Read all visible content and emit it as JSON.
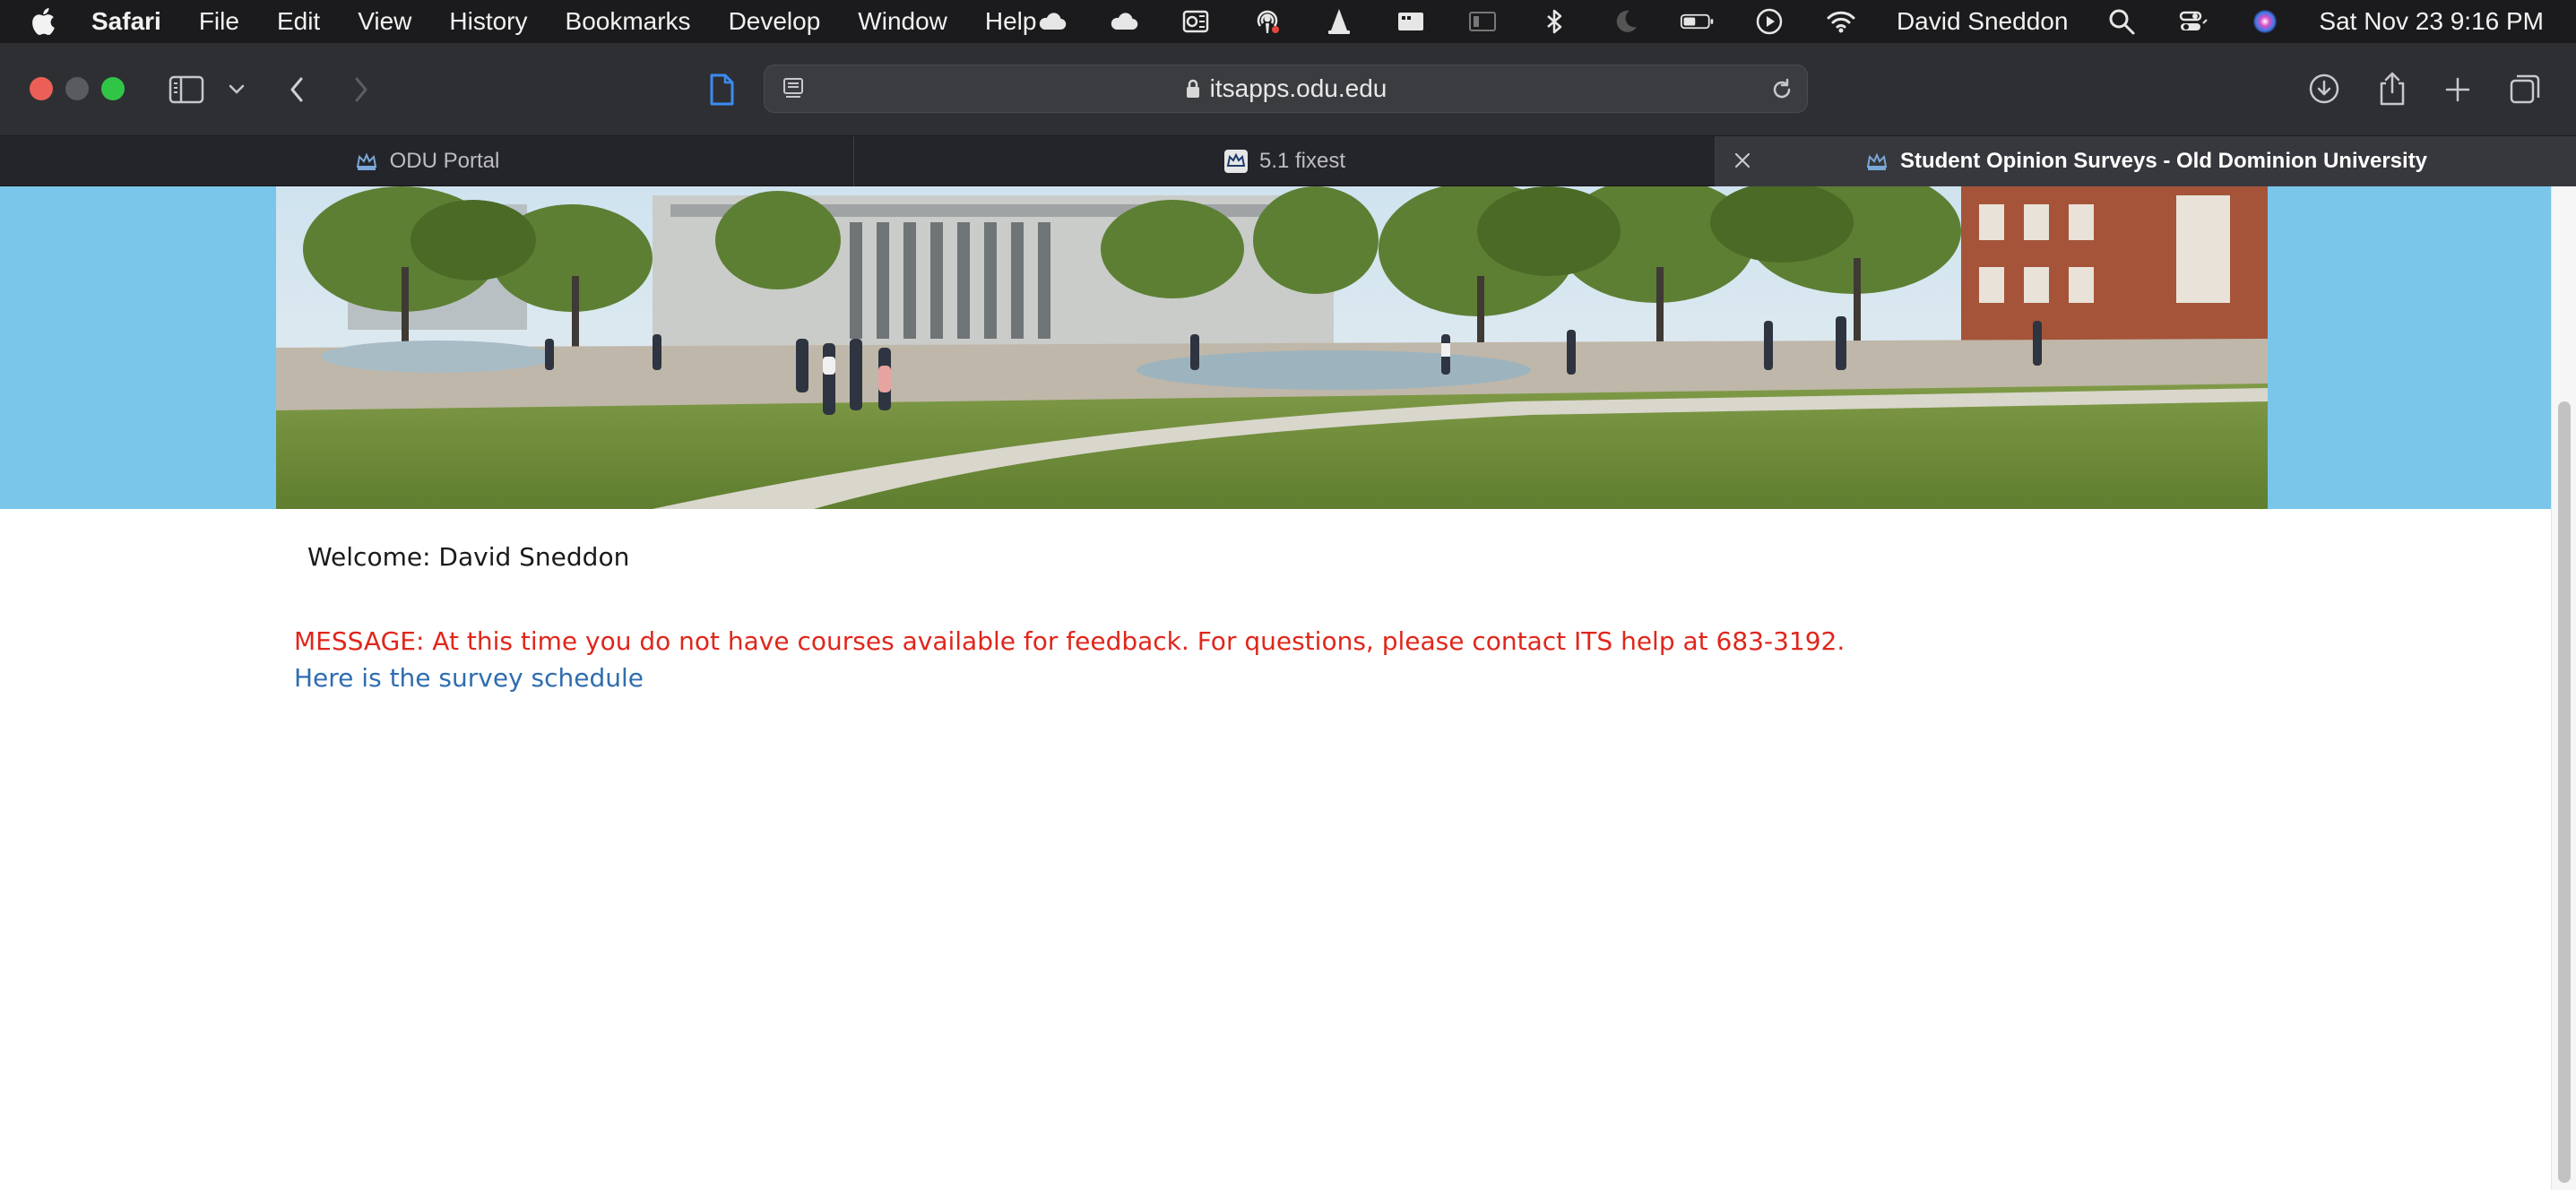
{
  "menubar": {
    "apple_icon": "apple-icon",
    "items": [
      "Safari",
      "File",
      "Edit",
      "View",
      "History",
      "Bookmarks",
      "Develop",
      "Window",
      "Help"
    ],
    "tray_icons": [
      "cloud-icon",
      "cloud-icon",
      "outlook-icon",
      "podcast-icon",
      "vlc-icon",
      "display-icon",
      "sidecar-icon",
      "bluetooth-icon",
      "moon-icon",
      "battery-icon",
      "play-icon",
      "wifi-icon"
    ],
    "user_name": "David Sneddon",
    "clock": "Sat Nov 23  9:16 PM"
  },
  "toolbar": {
    "url": "itsapps.odu.edu"
  },
  "tabs": [
    {
      "label": "ODU Portal",
      "favicon": "odu-crown-icon",
      "active": false
    },
    {
      "label": "5.1 fixest",
      "favicon": "odu-crown-icon",
      "active": false
    },
    {
      "label": "Student Opinion Surveys - Old Dominion University",
      "favicon": "odu-crown-icon",
      "active": true
    }
  ],
  "page": {
    "welcome": "Welcome: David Sneddon",
    "message": "MESSAGE: At this time you do not have courses available for feedback. For questions, please contact ITS help at 683-3192.",
    "schedule_link": "Here is the survey schedule"
  },
  "colors": {
    "hero_band": "#7ac6ea",
    "message_red": "#e0261b",
    "link_blue": "#2f6db0"
  }
}
